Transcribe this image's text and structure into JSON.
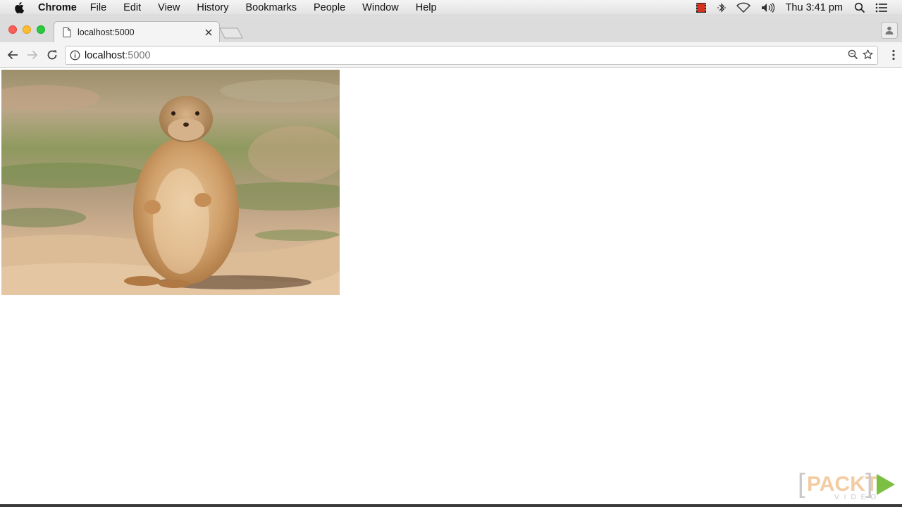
{
  "menubar": {
    "app_name": "Chrome",
    "items": [
      "File",
      "Edit",
      "View",
      "History",
      "Bookmarks",
      "People",
      "Window",
      "Help"
    ],
    "clock": "Thu 3:41 pm",
    "status_icons": [
      "screen-record-icon",
      "bluetooth-icon",
      "wifi-icon",
      "volume-icon",
      "spotlight-search-icon",
      "notification-list-icon"
    ]
  },
  "browser": {
    "tab": {
      "title": "localhost:5000",
      "favicon": "document-icon"
    },
    "address": {
      "host": "localhost",
      "port": ":5000"
    },
    "colors": {
      "close": "#fc5f57",
      "minimize": "#fdbc2e",
      "maximize": "#29c940"
    }
  },
  "page": {
    "image": {
      "subject": "prairie-dog-photo"
    }
  },
  "watermark": {
    "brand": "PACKT",
    "sub": "VIDEO",
    "accent": "#7cc043"
  }
}
